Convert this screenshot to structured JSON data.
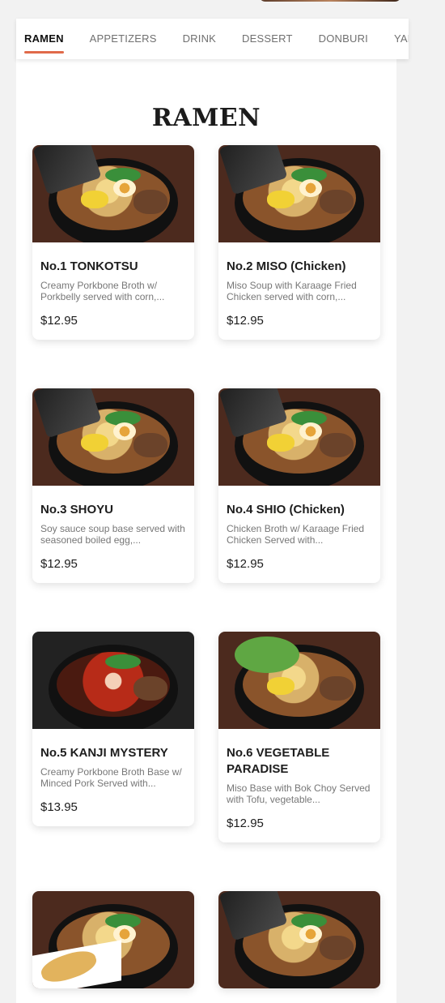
{
  "tabs": [
    {
      "label": "RAMEN",
      "active": true
    },
    {
      "label": "APPETIZERS",
      "active": false
    },
    {
      "label": "DRINK",
      "active": false
    },
    {
      "label": "DESSERT",
      "active": false
    },
    {
      "label": "DONBURI",
      "active": false
    },
    {
      "label": "YAKIS",
      "active": false
    }
  ],
  "section": {
    "title": "RAMEN"
  },
  "items": [
    {
      "name": "No.1 TONKOTSU",
      "description": "Creamy Porkbone Broth w/ Porkbelly served with corn,...",
      "price": "$12.95",
      "image_icon": "ramen-photo-icon"
    },
    {
      "name": "No.2 MISO (Chicken)",
      "description": "Miso Soup with Karaage Fried Chicken served with corn,...",
      "price": "$12.95",
      "image_icon": "ramen-photo-icon"
    },
    {
      "name": "No.3 SHOYU",
      "description": "Soy sauce soup base served with seasoned boiled egg,...",
      "price": "$12.95",
      "image_icon": "ramen-photo-icon"
    },
    {
      "name": "No.4 SHIO (Chicken)",
      "description": "Chicken Broth w/ Karaage Fried Chicken Served with...",
      "price": "$12.95",
      "image_icon": "ramen-photo-icon"
    },
    {
      "name": "No.5 KANJI MYSTERY",
      "description": "Creamy Porkbone Broth Base w/ Minced Pork Served with...",
      "price": "$13.95",
      "image_icon": "spicy-ramen-photo-icon"
    },
    {
      "name": "No.6 VEGETABLE PARADISE",
      "description": "Miso Base with Bok Choy Served with Tofu, vegetable...",
      "price": "$12.95",
      "image_icon": "vegetable-ramen-photo-icon"
    },
    {
      "name": "",
      "description": "",
      "price": "",
      "image_icon": "tempura-ramen-photo-icon"
    },
    {
      "name": "",
      "description": "",
      "price": "",
      "image_icon": "ramen-photo-icon"
    }
  ],
  "colors": {
    "accent": "#e06a4a",
    "background": "#f2f2f2",
    "card": "#ffffff",
    "text": "#1d1d1d",
    "muted_text": "#777777"
  }
}
